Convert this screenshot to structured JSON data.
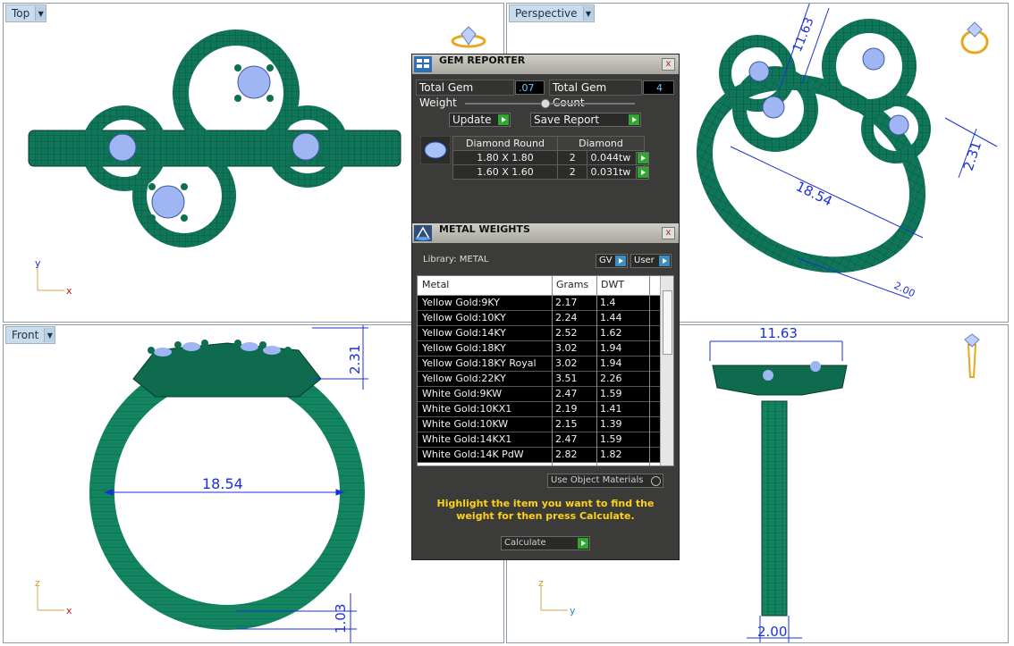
{
  "viewports": {
    "top": {
      "label": "Top"
    },
    "perspective": {
      "label": "Perspective"
    },
    "front": {
      "label": "Front"
    },
    "right": {
      "label": ""
    }
  },
  "axes": {
    "top": {
      "vertical": "y",
      "horizontal": "x"
    },
    "front": {
      "vertical": "z",
      "horizontal": "x"
    },
    "right": {
      "vertical": "z",
      "horizontal": "y"
    }
  },
  "dimensions": {
    "perspective_a": "11.63",
    "perspective_b": "2.31",
    "perspective_c": "18.54",
    "perspective_d": "2.00",
    "front_height": "2.31",
    "front_diameter": "18.54",
    "front_band": "1.03",
    "right_width": "11.63",
    "right_band": "2.00"
  },
  "gem_reporter": {
    "title": "GEM REPORTER",
    "close": "x",
    "total_weight_label": "Total Gem Weight",
    "total_weight_value": ".07",
    "total_count_label": "Total Gem Count",
    "total_count_value": "4",
    "update_label": "Update",
    "save_label": "Save Report",
    "table_headers": [
      "Diamond Round",
      "Diamond"
    ],
    "rows": [
      {
        "size": "1.80 X 1.80",
        "count": "2",
        "weight": "0.044tw"
      },
      {
        "size": "1.60 X 1.60",
        "count": "2",
        "weight": "0.031tw"
      }
    ]
  },
  "metal_weights": {
    "title": "METAL WEIGHTS",
    "close": "x",
    "library_label": "Library: METAL",
    "gv_label": "GV",
    "user_label": "User",
    "columns": [
      "Metal",
      "Grams",
      "DWT"
    ],
    "rows": [
      {
        "metal": "Yellow Gold:9KY",
        "grams": "2.17",
        "dwt": "1.4"
      },
      {
        "metal": "Yellow Gold:10KY",
        "grams": "2.24",
        "dwt": "1.44"
      },
      {
        "metal": "Yellow Gold:14KY",
        "grams": "2.52",
        "dwt": "1.62"
      },
      {
        "metal": "Yellow Gold:18KY",
        "grams": "3.02",
        "dwt": "1.94"
      },
      {
        "metal": "Yellow Gold:18KY Royal",
        "grams": "3.02",
        "dwt": "1.94"
      },
      {
        "metal": "Yellow Gold:22KY",
        "grams": "3.51",
        "dwt": "2.26"
      },
      {
        "metal": "White Gold:9KW",
        "grams": "2.47",
        "dwt": "1.59"
      },
      {
        "metal": "White Gold:10KX1",
        "grams": "2.19",
        "dwt": "1.41"
      },
      {
        "metal": "White Gold:10KW",
        "grams": "2.15",
        "dwt": "1.39"
      },
      {
        "metal": "White Gold:14KX1",
        "grams": "2.47",
        "dwt": "1.59"
      },
      {
        "metal": "White Gold:14K PdW",
        "grams": "2.82",
        "dwt": "1.82"
      }
    ],
    "use_object_materials": "Use Object Materials",
    "hint": "Highlight the item you want to find the weight for then press Calculate.",
    "calculate_label": "Calculate"
  },
  "colors": {
    "ring": "#0e6b4e",
    "ring_light": "#1f8f69",
    "gem": "#9fb6f2",
    "dimension": "#1b2fd8",
    "hint": "#ffd21a"
  }
}
